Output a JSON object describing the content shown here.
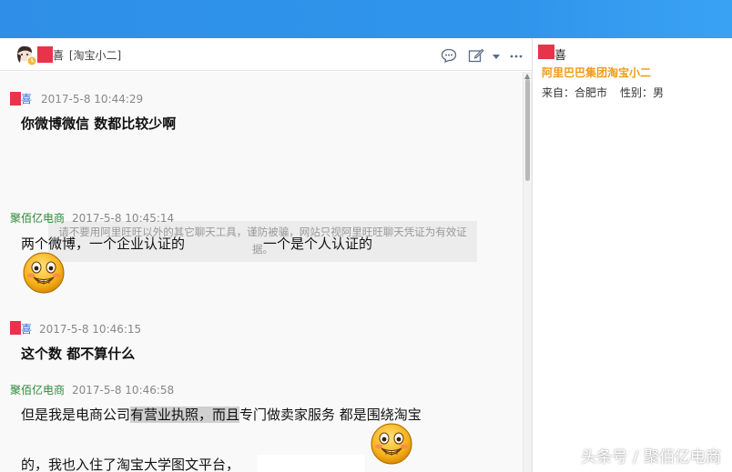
{
  "header": {
    "contact_name_tail": "喜",
    "contact_role": "[淘宝小二]",
    "icons": [
      "chat-bubble-icon",
      "edit-icon",
      "chevron-down-icon",
      "more-icon"
    ]
  },
  "messages": [
    {
      "sender": "喜",
      "time": "2017-5-8 10:44:29",
      "text": "你微博微信  数都比较少啊"
    },
    {
      "sender": "聚佰亿电商",
      "time": "2017-5-8 10:45:14",
      "text": "两个微博，一个企业认证的",
      "text_b": "一个是个人认证的"
    },
    {
      "sender": "喜",
      "time": "2017-5-8 10:46:15",
      "text": "这个数 都不算什么"
    },
    {
      "sender": "聚佰亿电商",
      "time": "2017-5-8 10:46:58",
      "text_pre": "但是我是电商公司",
      "text_hl": "有营业执照，而且",
      "text_post": "专门做卖家服务 都是围绕淘宝",
      "text_line2": "的，我也入住了淘宝大学图文平台，"
    }
  ],
  "notice": "请不要用阿里旺旺以外的其它聊天工具，谨防被骗，网站只视阿里旺旺聊天凭证为有效证据。",
  "side": {
    "name_tail": "喜",
    "shop": "阿里巴巴集团淘宝小二",
    "from_label": "来自：合肥市",
    "gender_label": "性别：男"
  },
  "watermark": {
    "left": "头条号",
    "sep": "/",
    "right": "聚佰亿电商"
  },
  "colors": {
    "top_bar": "#2f8fe8",
    "self_name": "#2b6bd6",
    "other_name": "#2e8b3a",
    "shop_name": "#f09a1a",
    "redaction": "#e8334a"
  }
}
